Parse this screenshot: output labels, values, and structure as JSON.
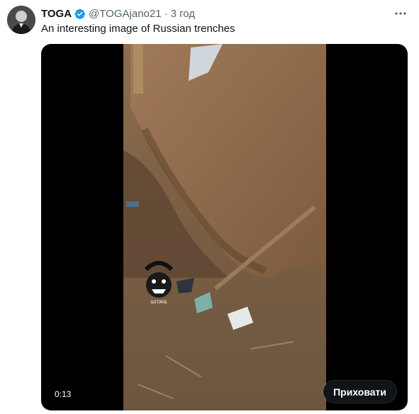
{
  "tweet": {
    "display_name": "TOGA",
    "handle": "@TOGAjano21",
    "separator": "·",
    "time": "3 год",
    "text": "An interesting image of Russian trenches",
    "verified_icon": "verified-badge-icon",
    "more_icon": "more-dots-icon"
  },
  "media": {
    "type": "video",
    "timestamp": "0:13",
    "hide_label": "Приховати",
    "sticker_caption": "ШПЗКБ"
  },
  "colors": {
    "verified_blue": "#1d9bf0",
    "text_primary": "#0f1419",
    "text_secondary": "#536471",
    "button_bg": "#0f1419"
  }
}
